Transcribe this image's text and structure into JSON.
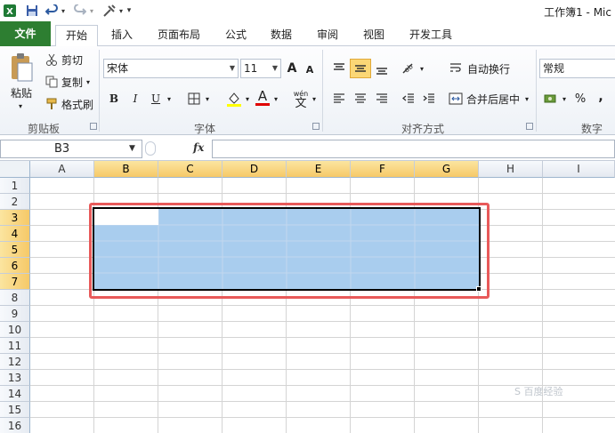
{
  "window": {
    "title": "工作簿1 - Mic"
  },
  "quick_access": {
    "save_icon": "save-icon",
    "undo_icon": "undo-icon",
    "redo_icon": "redo-icon",
    "customize_icon": "tools-icon",
    "more": "▾"
  },
  "tabs": [
    {
      "label": "文件"
    },
    {
      "label": "开始"
    },
    {
      "label": "插入"
    },
    {
      "label": "页面布局"
    },
    {
      "label": "公式"
    },
    {
      "label": "数据"
    },
    {
      "label": "审阅"
    },
    {
      "label": "视图"
    },
    {
      "label": "开发工具"
    }
  ],
  "clipboard": {
    "paste": "粘贴",
    "cut": "剪切",
    "copy": "复制",
    "format_painter": "格式刷",
    "group": "剪贴板"
  },
  "font": {
    "name": "宋体",
    "size": "11",
    "bold": "B",
    "italic": "I",
    "underline": "U",
    "font_color": "A",
    "phonetic": "wén",
    "phonetic_char": "文",
    "grow": "A",
    "shrink": "A",
    "group": "字体",
    "font_color_hex": "#e00000",
    "fill_color_hex": "#ffff00"
  },
  "alignment": {
    "wrap_text": "自动换行",
    "merge_center": "合并后居中",
    "group": "对齐方式"
  },
  "number": {
    "format": "常规",
    "percent": "%",
    "comma": ",",
    "group": "数字"
  },
  "formula_bar": {
    "name_box": "B3",
    "fx": "fx",
    "value": ""
  },
  "sheet": {
    "columns": [
      "A",
      "B",
      "C",
      "D",
      "E",
      "F",
      "G",
      "H",
      "I"
    ],
    "selected_columns": [
      "B",
      "C",
      "D",
      "E",
      "F",
      "G"
    ],
    "rows": [
      "1",
      "2",
      "3",
      "4",
      "5",
      "6",
      "7",
      "8",
      "9",
      "10",
      "11",
      "12",
      "13",
      "14",
      "15",
      "16"
    ],
    "selected_rows": [
      "3",
      "4",
      "5",
      "6",
      "7"
    ],
    "selection_range": "B3:G7",
    "highlight_color": "#e85a5a",
    "selection_color": "#a9cdee"
  },
  "watermark": "S 百度经验"
}
